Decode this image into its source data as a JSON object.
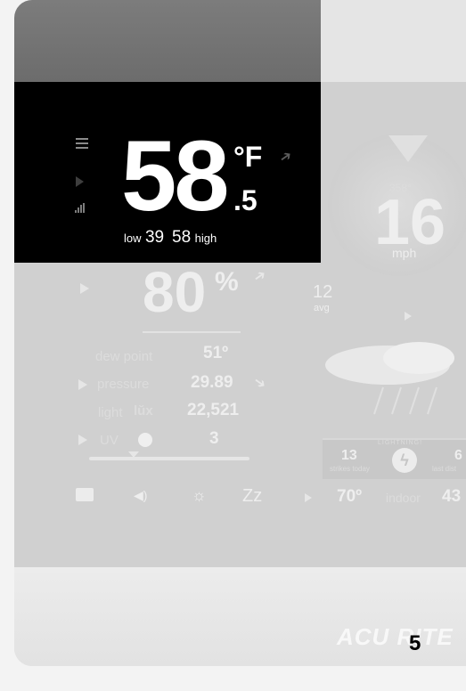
{
  "temperature": {
    "value": "58",
    "unit": "°F",
    "decimal": ".5",
    "low_label": "low",
    "low": "39",
    "high": "58",
    "high_label": "high"
  },
  "wind": {
    "direction": "358°",
    "speed": "16",
    "unit": "mph",
    "avg": "12",
    "avg_label": "avg"
  },
  "humidity": {
    "value": "80",
    "unit": "%"
  },
  "readings": {
    "dew_label": "dew point",
    "dew_value": "51º",
    "pressure_label": "pressure",
    "pressure_value": "29.89",
    "light_label": "light",
    "light_unit": "lŭx",
    "light_value": "22,521",
    "uv_label": "UV",
    "uv_value": "3"
  },
  "lightning": {
    "title": "LIGHTNING!",
    "strikes_today": "13",
    "strikes_label": "strikes today",
    "distance": "6",
    "distance_label": "last dist"
  },
  "bottom_bar": {
    "sleep_label": "Zz",
    "indoor_temp": "70º",
    "indoor_label": "indoor",
    "indoor_humidity": "43"
  },
  "brand": "ACU RITE",
  "page_number": "5",
  "icons": [
    "menu-icon",
    "play-icon",
    "signal-icon",
    "trend-arrow-icon",
    "folder-icon",
    "speaker-icon",
    "brightness-icon",
    "bolt-icon"
  ],
  "colors": {
    "highlight_panel": "#000000",
    "faded_text": "#eeeeee",
    "screen": "#d0d0d0"
  }
}
